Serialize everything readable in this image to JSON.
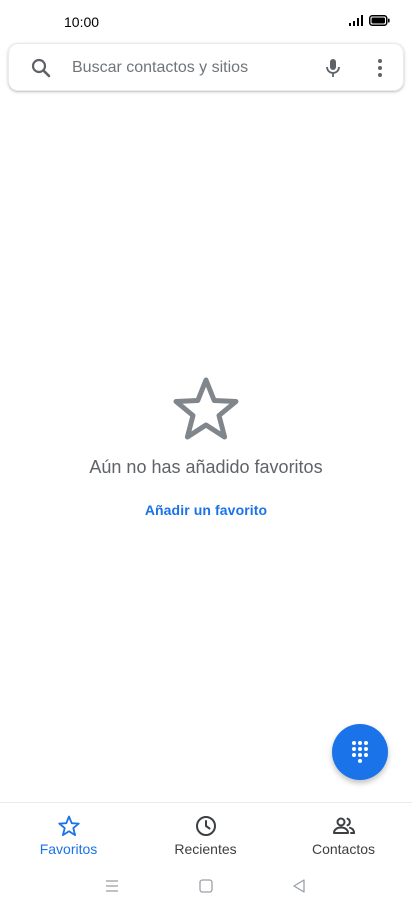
{
  "status_bar": {
    "time": "10:00"
  },
  "search": {
    "placeholder": "Buscar contactos y sitios"
  },
  "empty_state": {
    "title": "Aún no has añadido favoritos",
    "action": "Añadir un favorito"
  },
  "bottom_nav": {
    "items": [
      {
        "label": "Favoritos",
        "icon": "star-icon",
        "active": true
      },
      {
        "label": "Recientes",
        "icon": "clock-icon",
        "active": false
      },
      {
        "label": "Contactos",
        "icon": "people-icon",
        "active": false
      }
    ]
  },
  "colors": {
    "accent": "#1a73e8",
    "muted_text": "#5f6368",
    "icon_gray": "#5f6368"
  }
}
